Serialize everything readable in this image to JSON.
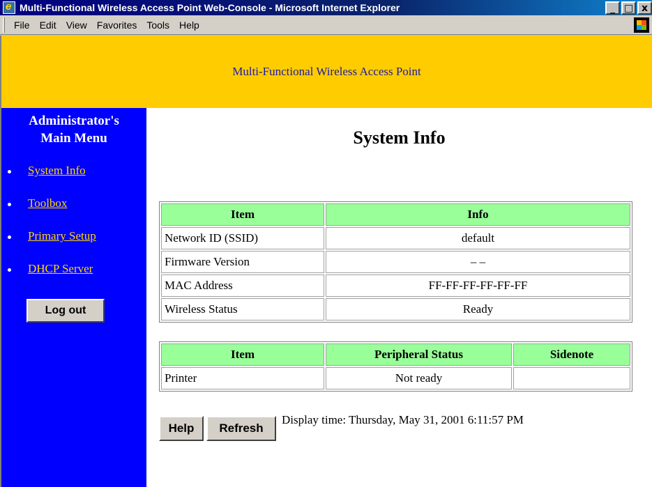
{
  "window": {
    "title": "Multi-Functional Wireless Access Point Web-Console - Microsoft Internet Explorer",
    "buttons": [
      "_",
      "□",
      "x"
    ]
  },
  "menubar": {
    "items": [
      "File",
      "Edit",
      "View",
      "Favorites",
      "Tools",
      "Help"
    ]
  },
  "banner": {
    "text": "Multi-Functional Wireless Access Point"
  },
  "sidebar": {
    "title_line1": "Administrator's",
    "title_line2": "Main Menu",
    "links": [
      "System Info",
      "Toolbox",
      "Primary Setup",
      "DHCP Server"
    ],
    "logout_label": "Log out"
  },
  "main": {
    "page_title": "System Info",
    "info_table": {
      "headers": [
        "Item",
        "Info"
      ],
      "rows": [
        [
          "Network ID (SSID)",
          "default"
        ],
        [
          "Firmware Version",
          "– –"
        ],
        [
          "MAC Address",
          "FF-FF-FF-FF-FF-FF"
        ],
        [
          "Wireless Status",
          "Ready"
        ]
      ]
    },
    "peripheral_table": {
      "headers": [
        "Item",
        "Peripheral Status",
        "Sidenote"
      ],
      "rows": [
        [
          "Printer",
          "Not ready",
          ""
        ]
      ]
    },
    "help_label": "Help",
    "refresh_label": "Refresh",
    "display_time": "Display time: Thursday, May 31, 2001 6:11:57 PM"
  },
  "colors": {
    "banner_bg": "#ffcc00",
    "sidebar_bg": "#0000ff",
    "link": "#ffd700",
    "table_header_bg": "#99ff99"
  },
  "icons": [
    "ie-app-icon",
    "windows-logo-icon",
    "bullet-icon"
  ]
}
